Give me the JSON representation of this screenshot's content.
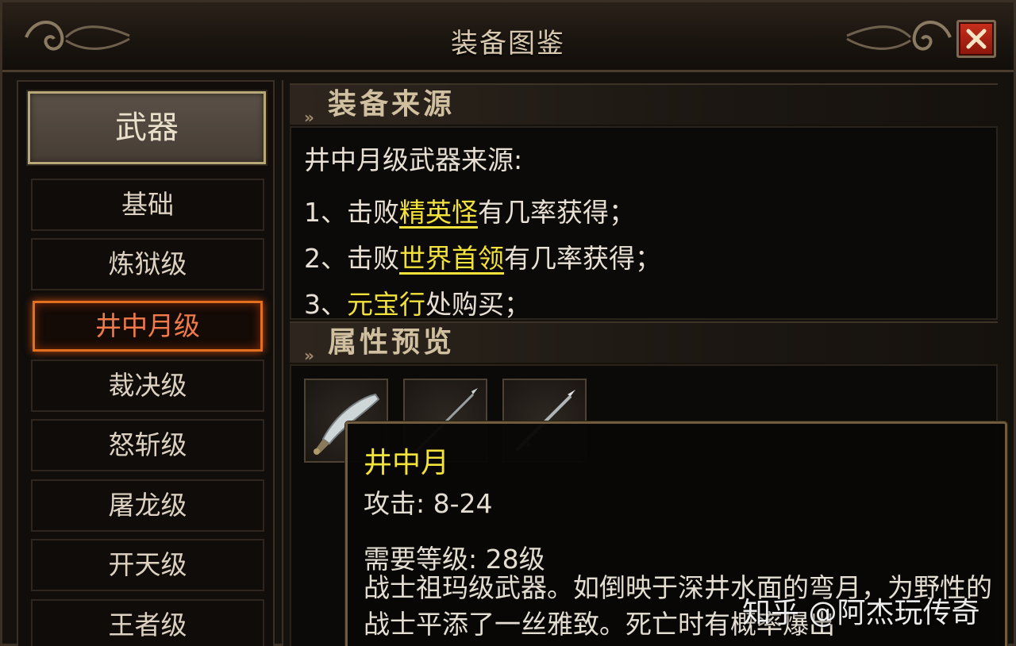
{
  "window": {
    "title": "装备图鉴"
  },
  "sidebar": {
    "category": "武器",
    "items": [
      {
        "label": "基础"
      },
      {
        "label": "炼狱级"
      },
      {
        "label": "井中月级"
      },
      {
        "label": "裁决级"
      },
      {
        "label": "怒斩级"
      },
      {
        "label": "屠龙级"
      },
      {
        "label": "开天级"
      },
      {
        "label": "王者级"
      }
    ],
    "selected_index": 2
  },
  "source_section": {
    "heading": "装备来源",
    "title": "井中月级武器来源:",
    "lines": [
      {
        "prefix": "1、击败",
        "highlight": "精英怪",
        "suffix": "有几率获得；"
      },
      {
        "prefix": "2、击败",
        "highlight": "世界首领",
        "suffix": "有几率获得；"
      },
      {
        "prefix": "3、",
        "highlight": "元宝行",
        "suffix": "处购买；"
      }
    ]
  },
  "preview_section": {
    "heading": "属性预览",
    "slots": [
      {
        "icon": "broadsword-icon"
      },
      {
        "icon": "spear-icon"
      },
      {
        "icon": "blade-icon"
      }
    ]
  },
  "tooltip": {
    "name": "井中月",
    "attack": "攻击: 8-24",
    "level_req": "需要等级: 28级",
    "description": "战士祖玛级武器。如倒映于深井水面的弯月，为野性的战士平添了一丝雅致。死亡时有概率爆出"
  },
  "watermark": "知乎 @阿杰玩传奇",
  "colors": {
    "highlight": "#f2e23a",
    "active_item": "#f07a4a",
    "close_red": "#c8301c"
  }
}
